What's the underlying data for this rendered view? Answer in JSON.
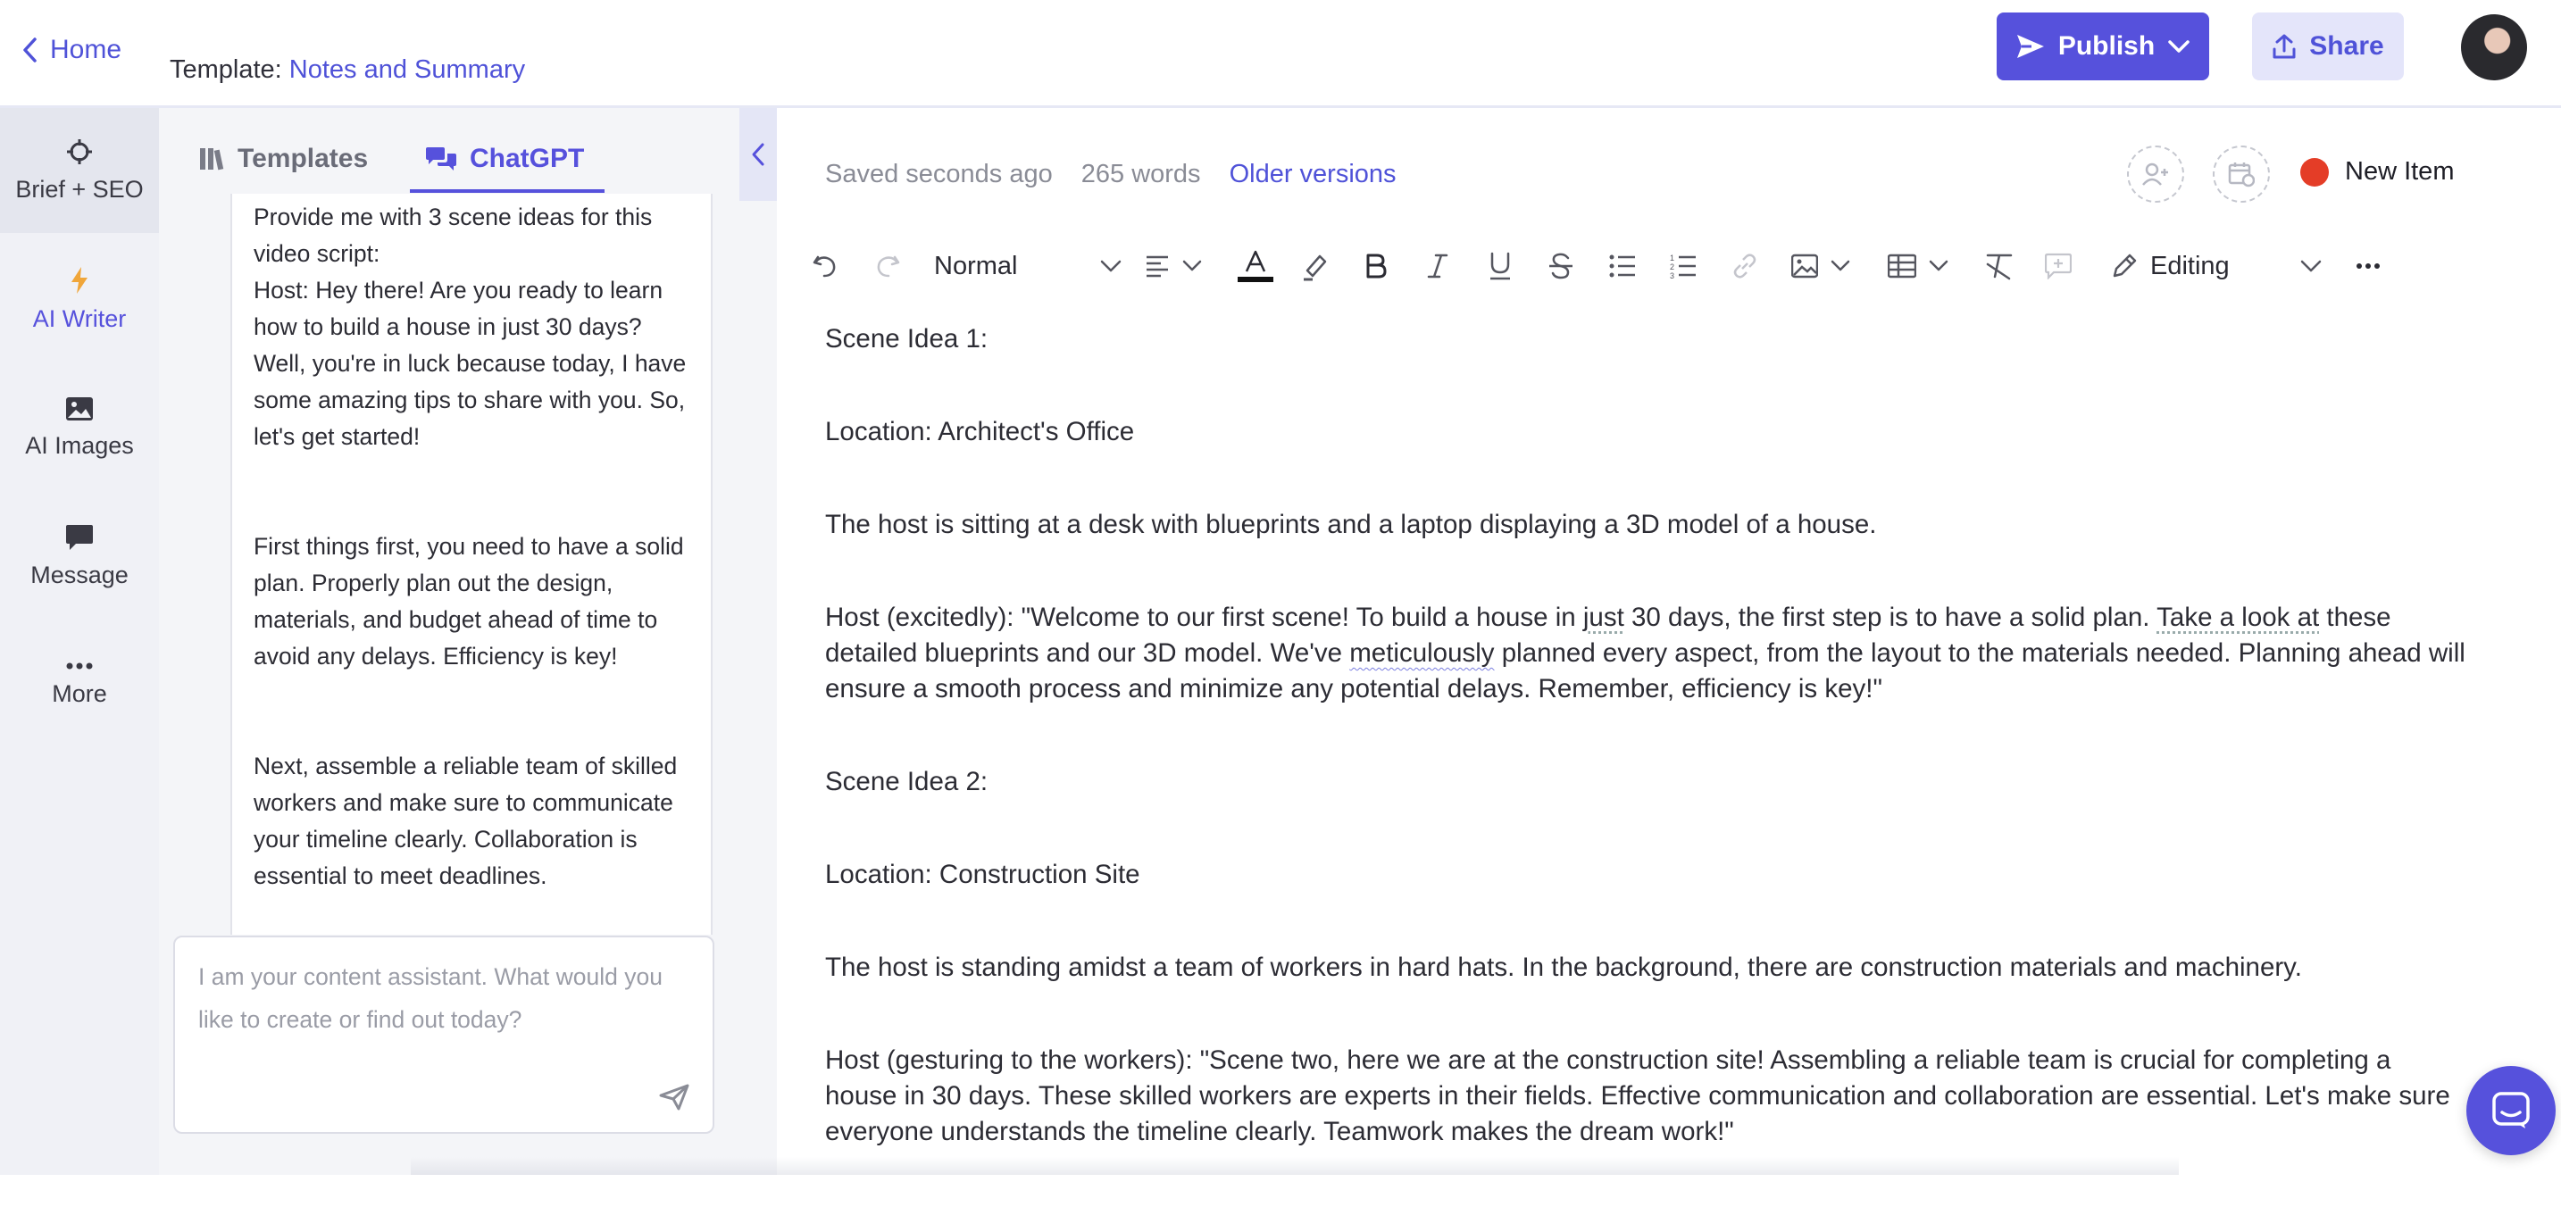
{
  "header": {
    "home_label": "Home",
    "template_prefix": "Template:",
    "template_name": "Notes and Summary",
    "publish_label": "Publish",
    "share_label": "Share"
  },
  "nav": {
    "items": [
      {
        "label": "Brief + SEO",
        "icon": "crosshair-icon"
      },
      {
        "label": "AI Writer",
        "icon": "lightning-icon"
      },
      {
        "label": "AI Images",
        "icon": "image-icon"
      },
      {
        "label": "Message",
        "icon": "message-icon"
      },
      {
        "label": "More",
        "icon": "more-dots-icon"
      }
    ],
    "active": "AI Writer"
  },
  "chat": {
    "tabs": [
      {
        "label": "Templates",
        "icon": "library-icon"
      },
      {
        "label": "ChatGPT",
        "icon": "chat-bubbles-icon"
      }
    ],
    "active_tab": "ChatGPT",
    "messages": [
      "Provide me with 3 scene ideas for this video script:",
      "Host: Hey there! Are you ready to learn how to build a house in just 30 days? Well, you're in luck because today, I have some amazing tips to share with you. So, let's get started!",
      "First things first, you need to have a solid plan. Properly plan out the design, materials, and budget ahead of time to avoid any delays. Efficiency is key!",
      "Next, assemble a reliable team of skilled workers and make sure to communicate your timeline clearly. Collaboration is essential to meet deadlines."
    ],
    "input_placeholder": "I am your content assistant. What would you like to create or find out today?"
  },
  "editor": {
    "saved_status": "Saved seconds ago",
    "word_count": "265 words",
    "older_versions": "Older versions",
    "status_label": "New Item",
    "status_color": "#e43d27",
    "toolbar": {
      "text_style": "Normal",
      "mode": "Editing"
    },
    "paragraphs": {
      "p1": "Scene Idea 1:",
      "p2": "Location: Architect's Office",
      "p3": "The host is sitting at a desk with blueprints and a laptop displaying a 3D model of a house.",
      "p4a": "Host (excitedly): \"Welcome to our first scene! To build a house in ",
      "p4b": "just",
      "p4c": " 30 days, the first step is to have a solid plan. ",
      "p4d": "Take a look at",
      "p4e": " these detailed blueprints and our 3D model. We've ",
      "p4f": "meticulously",
      "p4g": " planned every aspect, from the layout to the materials needed. Planning ahead will ensure a smooth process and minimize any potential delays. Remember, efficiency is key!\"",
      "p5": "Scene Idea 2:",
      "p6": "Location: Construction Site",
      "p7": "The host is standing amidst a team of workers in hard hats. In the background, there are construction materials and machinery.",
      "p8": "Host (gesturing to the workers): \"Scene two, here we are at the construction site! Assembling a reliable team is crucial for completing a house in 30 days. These skilled workers are experts in their fields. Effective communication and collaboration are essential. Let's make sure everyone understands the timeline clearly. Teamwork makes the dream work!\""
    }
  },
  "colors": {
    "accent": "#5651dc",
    "accent_light": "#e4e5fa"
  }
}
